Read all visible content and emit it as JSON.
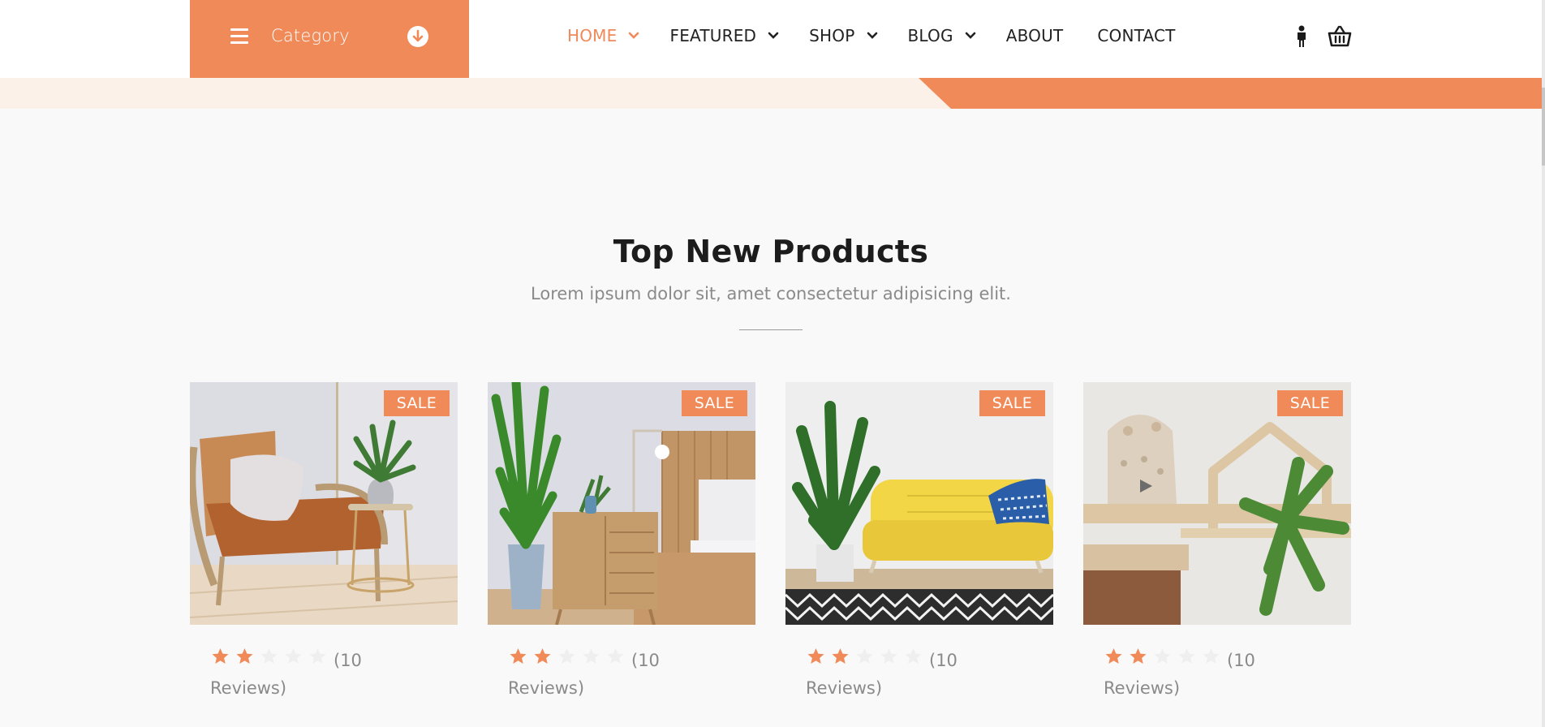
{
  "header": {
    "category_label": "Category",
    "nav": [
      {
        "label": "HOME",
        "active": true,
        "has_dropdown": true
      },
      {
        "label": "FEATURED",
        "active": false,
        "has_dropdown": true
      },
      {
        "label": "SHOP",
        "active": false,
        "has_dropdown": true
      },
      {
        "label": "BLOG",
        "active": false,
        "has_dropdown": true
      },
      {
        "label": "ABOUT",
        "active": false,
        "has_dropdown": false
      },
      {
        "label": "CONTACT",
        "active": false,
        "has_dropdown": false
      }
    ],
    "icons": {
      "menu": "hamburger-icon",
      "category_toggle": "arrow-down-circle-icon",
      "account": "person-icon",
      "cart": "basket-icon"
    }
  },
  "section": {
    "title": "Top New Products",
    "subtitle": "Lorem ipsum dolor sit, amet consectetur adipisicing elit."
  },
  "products": [
    {
      "badge": "SALE",
      "rating": 2,
      "max_rating": 5,
      "reviews_text": "(10 Reviews)",
      "image": "orange armchair with pillow and plant"
    },
    {
      "badge": "SALE",
      "rating": 2,
      "max_rating": 5,
      "reviews_text": "(10 Reviews)",
      "image": "wooden bedroom dresser with plants and lamp"
    },
    {
      "badge": "SALE",
      "rating": 2,
      "max_rating": 5,
      "reviews_text": "(10 Reviews)",
      "image": "yellow sofa with blue pillow and plant"
    },
    {
      "badge": "SALE",
      "rating": 2,
      "max_rating": 5,
      "reviews_text": "(10 Reviews)",
      "image": "wooden shelf with plush toy and plant"
    }
  ],
  "colors": {
    "accent": "#f08a58",
    "text": "#222222",
    "muted": "#8a8a8a",
    "background": "#f9f9f9"
  }
}
